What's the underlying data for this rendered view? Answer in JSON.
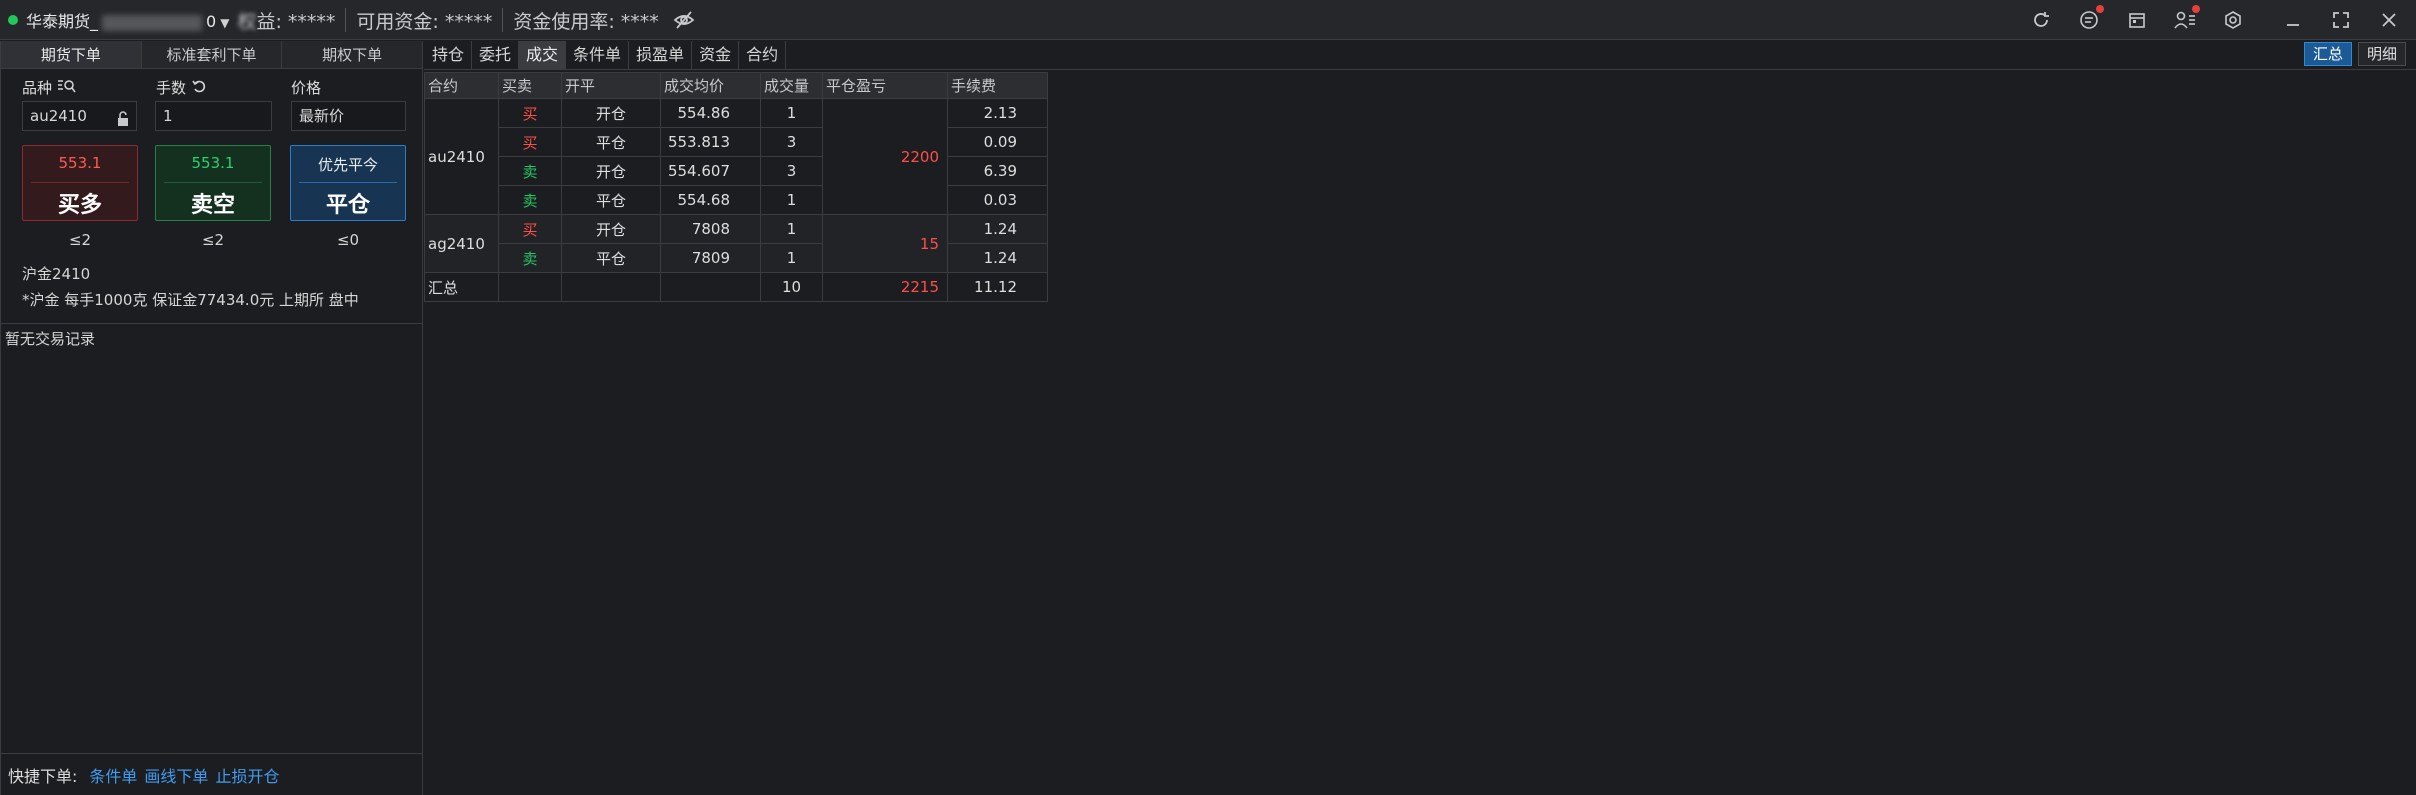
{
  "titlebar": {
    "account": "华泰期货_",
    "account_tail": "0",
    "equity_label": "权益: *****",
    "equity_prefix": "权",
    "equity_rest": "益: *****",
    "available_label": "可用资金: *****",
    "usage_label": "资金使用率: ****",
    "icons": [
      "refresh-icon",
      "message-icon",
      "calendar-icon",
      "user-list-icon",
      "settings-icon",
      "minimize-icon",
      "fullscreen-icon",
      "close-icon"
    ]
  },
  "left": {
    "tabs": [
      "期货下单",
      "标准套利下单",
      "期权下单"
    ],
    "labels": {
      "symbol": "品种",
      "qty": "手数",
      "price": "价格"
    },
    "inputs": {
      "symbol": "au2410",
      "qty": "1",
      "price": "最新价"
    },
    "buy": {
      "price": "553.1",
      "label": "买多",
      "limit": "≤2"
    },
    "sell": {
      "price": "553.1",
      "label": "卖空",
      "limit": "≤2"
    },
    "close": {
      "top": "优先平今",
      "label": "平仓",
      "limit": "≤0"
    },
    "contract_name": "沪金2410",
    "contract_info": "*沪金 每手1000克 保证金77434.0元 上期所 盘中",
    "no_record": "暂无交易记录",
    "quick": {
      "label": "快捷下单:",
      "links": [
        "条件单",
        "画线下单",
        "止损开仓"
      ]
    }
  },
  "right": {
    "tabs": [
      "持仓",
      "委托",
      "成交",
      "条件单",
      "损盈单",
      "资金",
      "合约"
    ],
    "active_tab": "成交",
    "view_buttons": [
      "汇总",
      "明细"
    ],
    "columns": [
      "合约",
      "买卖",
      "开平",
      "成交均价",
      "成交量",
      "平仓盈亏",
      "手续费"
    ],
    "groups": [
      {
        "contract": "au2410",
        "pnl": "2200",
        "rows": [
          {
            "side": "买",
            "oc": "开仓",
            "price": "554.86",
            "qty": "1",
            "fee": "2.13"
          },
          {
            "side": "买",
            "oc": "平仓",
            "price": "553.813",
            "qty": "3",
            "fee": "0.09"
          },
          {
            "side": "卖",
            "oc": "开仓",
            "price": "554.607",
            "qty": "3",
            "fee": "6.39"
          },
          {
            "side": "卖",
            "oc": "平仓",
            "price": "554.68",
            "qty": "1",
            "fee": "0.03"
          }
        ]
      },
      {
        "contract": "ag2410",
        "pnl": "15",
        "rows": [
          {
            "side": "买",
            "oc": "开仓",
            "price": "7808",
            "qty": "1",
            "fee": "1.24"
          },
          {
            "side": "卖",
            "oc": "平仓",
            "price": "7809",
            "qty": "1",
            "fee": "1.24"
          }
        ]
      }
    ],
    "summary": {
      "label": "汇总",
      "qty": "10",
      "pnl": "2215",
      "fee": "11.12"
    }
  }
}
